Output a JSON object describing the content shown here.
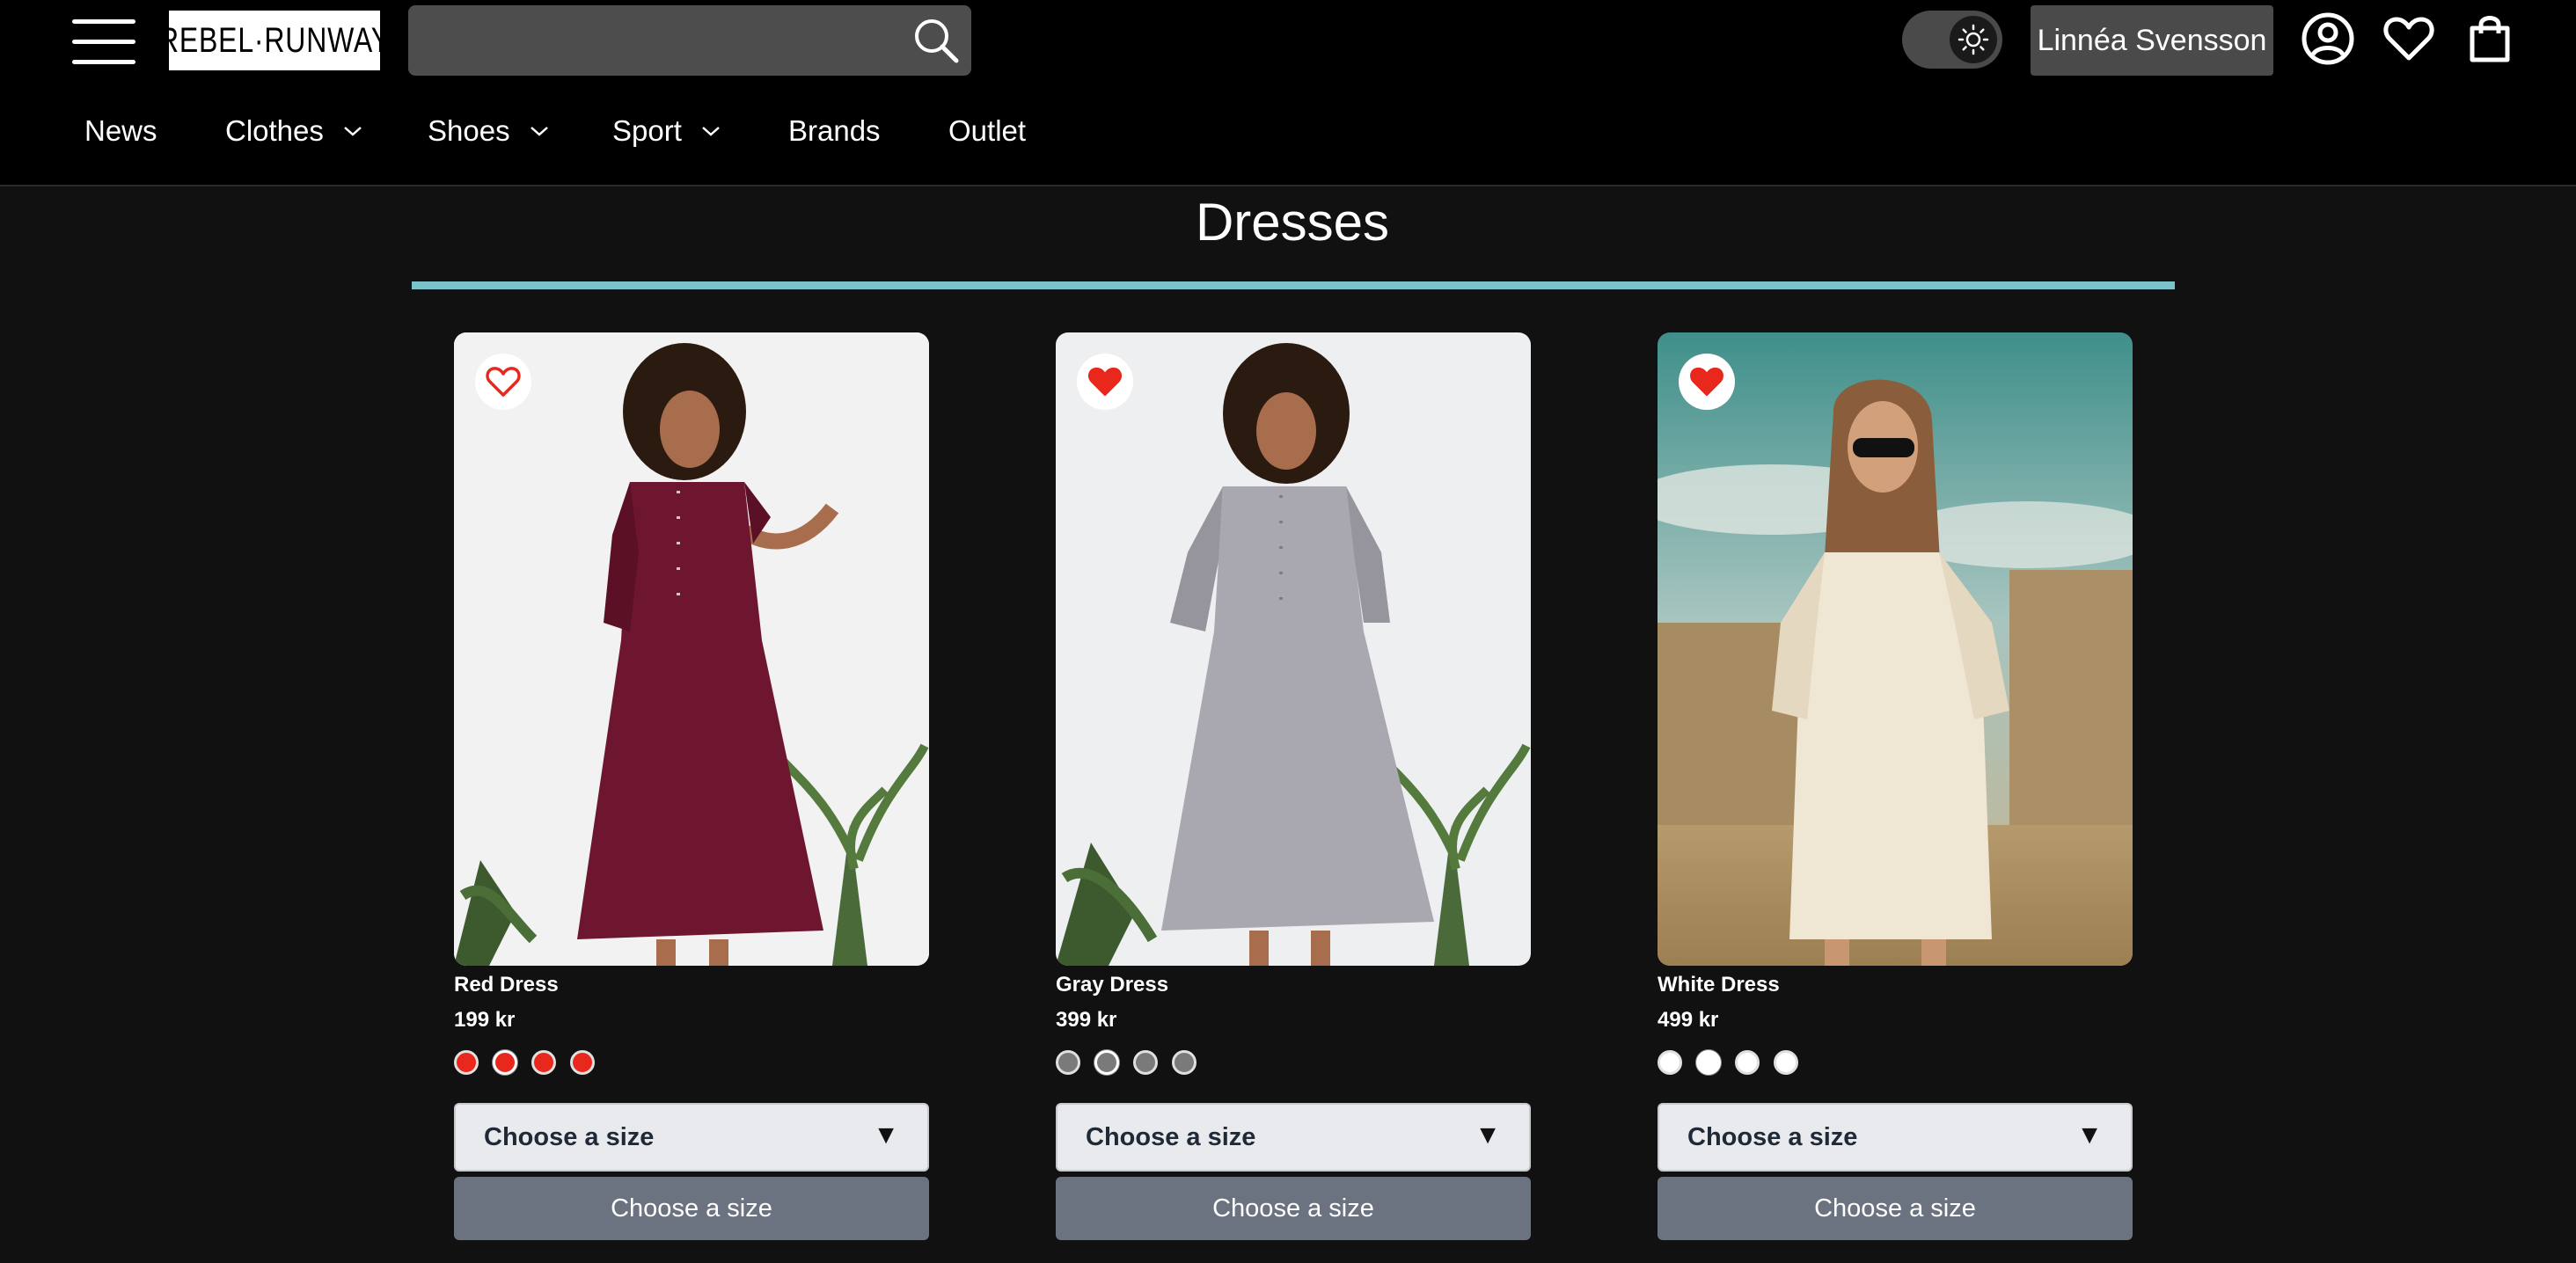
{
  "header": {
    "logo_text": "REBEL·RUNWAY",
    "search": {
      "value": "",
      "placeholder": ""
    },
    "theme_toggle_icon": "sun-icon",
    "user_name": "Linnéa Svensson",
    "icons": [
      "account-icon",
      "heart-icon",
      "shopping-bag-icon"
    ]
  },
  "nav": {
    "items": [
      {
        "label": "News",
        "dropdown": false
      },
      {
        "label": "Clothes",
        "dropdown": true
      },
      {
        "label": "Shoes",
        "dropdown": true
      },
      {
        "label": "Sport",
        "dropdown": true
      },
      {
        "label": "Brands",
        "dropdown": false
      },
      {
        "label": "Outlet",
        "dropdown": false
      }
    ]
  },
  "page": {
    "title": "Dresses",
    "accent_color": "#7cc3c9"
  },
  "products": [
    {
      "name": "Red Dress",
      "price": "199 kr",
      "favorited": false,
      "swatch_color": "#e8281c",
      "size_select_label": "Choose a size",
      "size_button_label": "Choose a size"
    },
    {
      "name": "Gray Dress",
      "price": "399 kr",
      "favorited": true,
      "swatch_color": "#7a7a7a",
      "size_select_label": "Choose a size",
      "size_button_label": "Choose a size"
    },
    {
      "name": "White Dress",
      "price": "499 kr",
      "favorited": true,
      "swatch_color": "#ffffff",
      "size_select_label": "Choose a size",
      "size_button_label": "Choose a size"
    }
  ]
}
